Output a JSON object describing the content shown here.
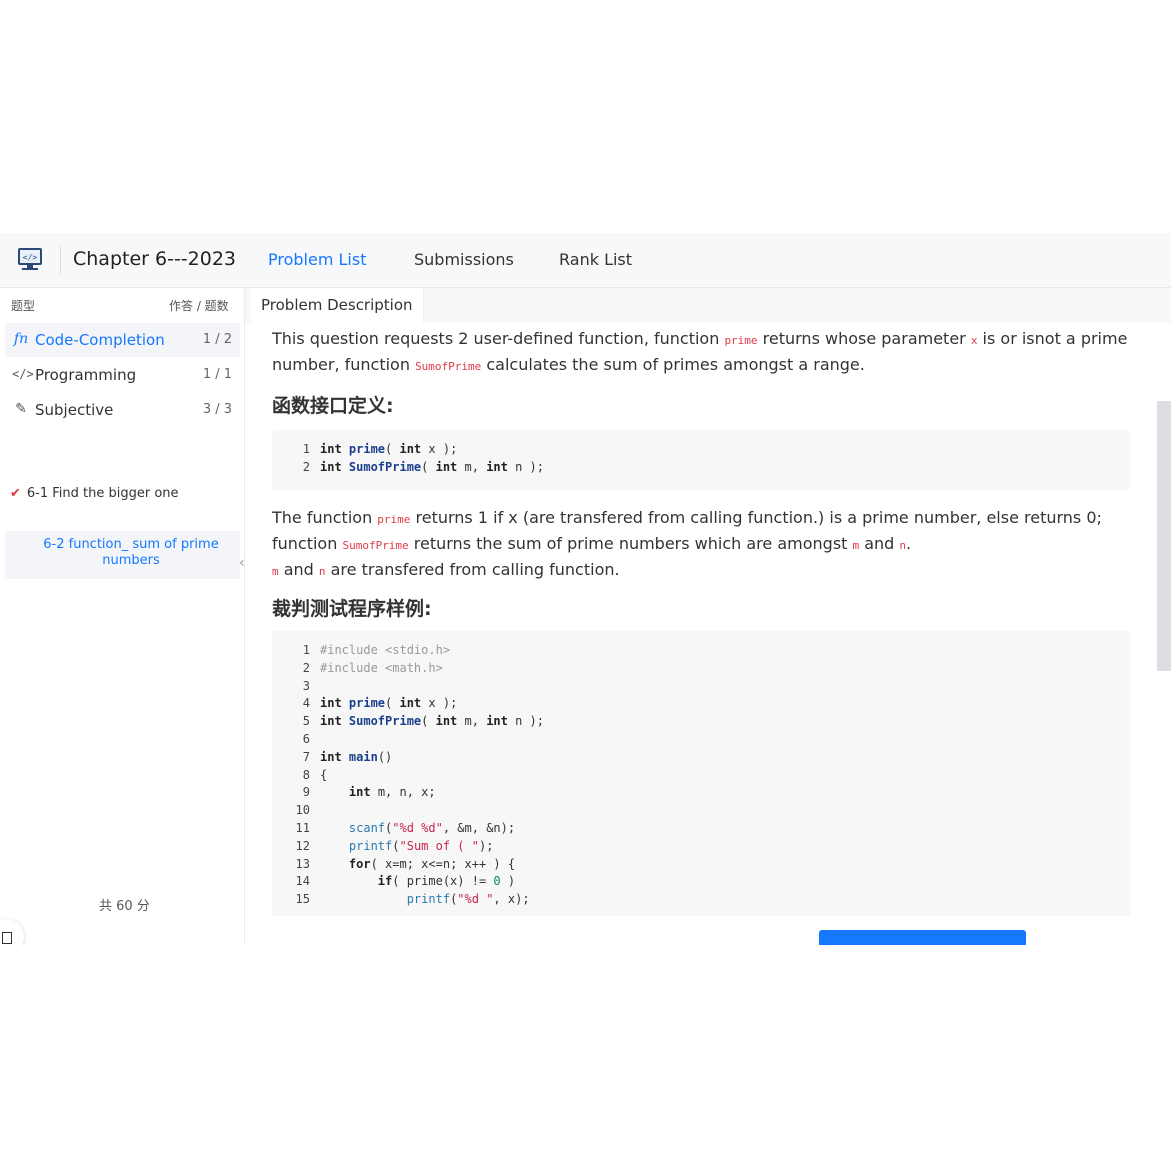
{
  "header": {
    "title": "Chapter 6---2023",
    "nav": [
      "Problem List",
      "Submissions",
      "Rank List"
    ],
    "active_nav": 0
  },
  "sidebar": {
    "col_type": "题型",
    "col_progress": "作答 / 题数",
    "categories": [
      {
        "icon": "function-icon",
        "label": "Code-Completion",
        "count": "1 / 2"
      },
      {
        "icon": "code-icon",
        "label": "Programming",
        "count": "1 / 1"
      },
      {
        "icon": "pencil-icon",
        "label": "Subjective",
        "count": "3 / 3"
      }
    ],
    "problems": [
      {
        "label": "6-1 Find the bigger one",
        "solved": true
      },
      {
        "label": "6-2 function_ sum of prime numbers",
        "solved": false
      }
    ],
    "total": "共 60 分"
  },
  "main": {
    "tab": "Problem Description",
    "intro": {
      "t1": "This question requests 2 user-defined function, function ",
      "c1": "prime",
      "t2": " returns whose parameter ",
      "c2": "x",
      "t3": " is or isnot a prime number, function ",
      "c3": "SumofPrime",
      "t4": " calculates the sum of primes amongst a range."
    },
    "heading1": "函数接口定义:",
    "heading2": "裁判测试程序样例:",
    "desc": {
      "t1": "The function ",
      "c1": "prime",
      "t2": " returns 1 if x (are transfered from calling function.) is a prime number, else returns 0; function ",
      "c2": "SumofPrime",
      "t3": " returns the sum of prime numbers which are amongst ",
      "c3": "m",
      "t4": " and ",
      "c4": "n",
      "t5": ".",
      "c5": "m",
      "t6": " and ",
      "c6": "n",
      "t7": " are transfered from calling function."
    }
  },
  "code1": [
    [
      [
        "1",
        "ln"
      ],
      [
        "int ",
        "kw"
      ],
      [
        "prime",
        "fn"
      ],
      [
        "( ",
        ""
      ],
      [
        "int ",
        "kw"
      ],
      [
        "x );",
        ""
      ]
    ],
    [
      [
        "2",
        "ln"
      ],
      [
        "int ",
        "kw"
      ],
      [
        "SumofPrime",
        "fn"
      ],
      [
        "( ",
        ""
      ],
      [
        "int ",
        "kw"
      ],
      [
        "m, ",
        ""
      ],
      [
        "int ",
        "kw"
      ],
      [
        "n );",
        ""
      ]
    ]
  ],
  "code2": [
    [
      [
        "1",
        "ln"
      ],
      [
        "#include <stdio.h>",
        "cm"
      ]
    ],
    [
      [
        "2",
        "ln"
      ],
      [
        "#include <math.h>",
        "cm"
      ]
    ],
    [
      [
        "3",
        "ln"
      ]
    ],
    [
      [
        "4",
        "ln"
      ],
      [
        "int ",
        "kw"
      ],
      [
        "prime",
        "fn"
      ],
      [
        "( ",
        ""
      ],
      [
        "int ",
        "kw"
      ],
      [
        "x );",
        ""
      ]
    ],
    [
      [
        "5",
        "ln"
      ],
      [
        "int ",
        "kw"
      ],
      [
        "SumofPrime",
        "fn"
      ],
      [
        "( ",
        ""
      ],
      [
        "int ",
        "kw"
      ],
      [
        "m, ",
        ""
      ],
      [
        "int ",
        "kw"
      ],
      [
        "n );",
        ""
      ]
    ],
    [
      [
        "6",
        "ln"
      ]
    ],
    [
      [
        "7",
        "ln"
      ],
      [
        "int ",
        "kw"
      ],
      [
        "main",
        "fn"
      ],
      [
        "()",
        ""
      ]
    ],
    [
      [
        "8",
        "ln"
      ],
      [
        "{",
        ""
      ]
    ],
    [
      [
        "9",
        "ln"
      ],
      [
        "    ",
        ""
      ],
      [
        "int ",
        "kw"
      ],
      [
        "m, n, x;",
        ""
      ]
    ],
    [
      [
        "10",
        "ln"
      ]
    ],
    [
      [
        "11",
        "ln"
      ],
      [
        "    ",
        ""
      ],
      [
        "scanf",
        "bl"
      ],
      [
        "(",
        ""
      ],
      [
        "\"%d %d\"",
        "str"
      ],
      [
        ", &m, &n);",
        ""
      ]
    ],
    [
      [
        "12",
        "ln"
      ],
      [
        "    ",
        ""
      ],
      [
        "printf",
        "bl"
      ],
      [
        "(",
        ""
      ],
      [
        "\"Sum of ( \"",
        "str"
      ],
      [
        ");",
        ""
      ]
    ],
    [
      [
        "13",
        "ln"
      ],
      [
        "    ",
        ""
      ],
      [
        "for",
        "kw"
      ],
      [
        "( x=m; x<=n; x++ ) {",
        ""
      ]
    ],
    [
      [
        "14",
        "ln"
      ],
      [
        "        ",
        ""
      ],
      [
        "if",
        "kw"
      ],
      [
        "( prime(x) != ",
        ""
      ],
      [
        "0",
        "num"
      ],
      [
        " )",
        ""
      ]
    ],
    [
      [
        "15",
        "ln"
      ],
      [
        "            ",
        ""
      ],
      [
        "printf",
        "bl"
      ],
      [
        "(",
        ""
      ],
      [
        "\"%d \"",
        "str"
      ],
      [
        ", x);",
        ""
      ]
    ]
  ]
}
